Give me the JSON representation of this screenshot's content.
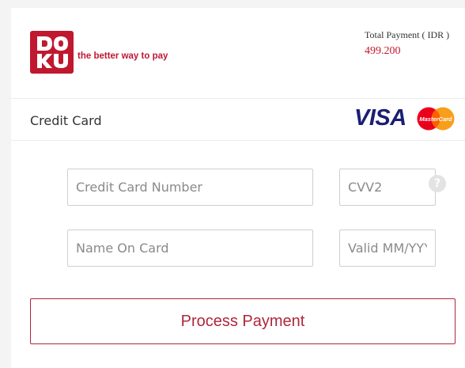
{
  "brand": {
    "logo_text": "DOKU",
    "tagline": "the better way to pay",
    "color": "#c0182f"
  },
  "payment": {
    "total_label": "Total Payment ( IDR )",
    "total_amount": "499.200"
  },
  "method": {
    "label": "Credit Card",
    "card_brands": [
      "VISA",
      "MasterCard"
    ]
  },
  "form": {
    "card_number_placeholder": "Credit Card Number",
    "cvv_placeholder": "CVV2",
    "cvv_help_icon": "?",
    "name_placeholder": "Name On Card",
    "valid_placeholder": "Valid MM/YYYY"
  },
  "actions": {
    "process_label": "Process Payment",
    "accent_color": "#b0263a"
  }
}
